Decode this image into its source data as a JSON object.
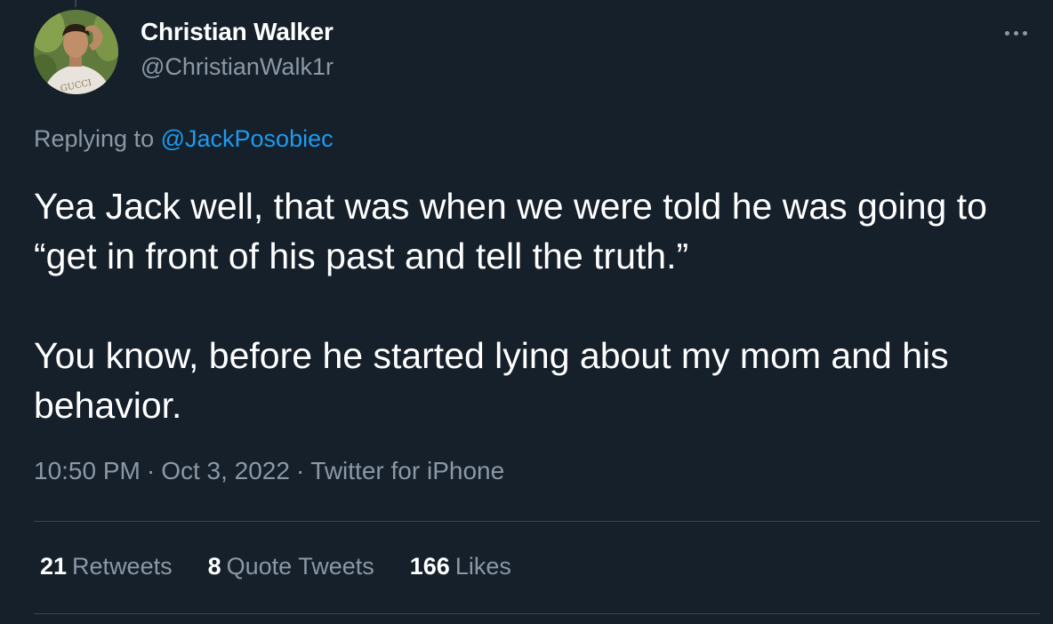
{
  "author": {
    "name": "Christian Walker",
    "handle": "@ChristianWalk1r",
    "avatar_shirt_text": "GUCCI"
  },
  "reply": {
    "prefix": "Replying to",
    "mention": "@JackPosobiec"
  },
  "tweet": {
    "paragraph_1": "Yea Jack well, that was when we were told he was going to “get in front of his past and tell the truth.”",
    "paragraph_2": "You know, before he started lying about my mom and his behavior."
  },
  "meta": {
    "time": "10:50 PM",
    "date": "Oct 3, 2022",
    "source": "Twitter for iPhone",
    "separator": "·"
  },
  "stats": {
    "retweets_count": "21",
    "retweets_label": "Retweets",
    "quotes_count": "8",
    "quotes_label": "Quote Tweets",
    "likes_count": "166",
    "likes_label": "Likes"
  },
  "colors": {
    "background": "#15202b",
    "link": "#1d9bf0",
    "secondary_text": "#8b98a5",
    "divider": "#38444d"
  },
  "icons": {
    "more": "more-horizontal-icon"
  }
}
